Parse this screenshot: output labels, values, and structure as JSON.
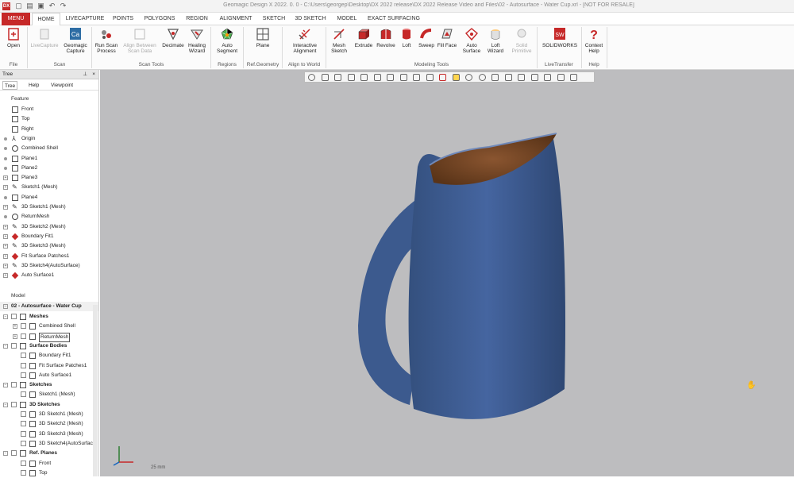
{
  "window": {
    "title": "Geomagic Design X 2022. 0. 0 - C:\\Users\\georgep\\Desktop\\DX 2022 release\\DX 2022 Release Video and Files\\02 - Autosurface - Water Cup.xrl - [NOT FOR RESALE]",
    "app_logo": "DX",
    "quick_access": [
      "new-icon",
      "open-icon",
      "save-icon",
      "undo-icon",
      "redo-icon"
    ]
  },
  "tabs": [
    "MENU",
    "HOME",
    "LIVECAPTURE",
    "POINTS",
    "POLYGONS",
    "REGION",
    "ALIGNMENT",
    "SKETCH",
    "3D SKETCH",
    "MODEL",
    "EXACT SURFACING"
  ],
  "active_tab": "HOME",
  "ribbon": {
    "groups": [
      {
        "label": "File",
        "buttons": [
          {
            "label": "Open",
            "icon": "open-icon"
          }
        ]
      },
      {
        "label": "Scan",
        "buttons": [
          {
            "label": "LiveCapture",
            "icon": "livecapture-icon",
            "disabled": true
          },
          {
            "label": "Geomagic Capture",
            "icon": "capture-icon"
          }
        ]
      },
      {
        "label": "Scan Tools",
        "buttons": [
          {
            "label": "Run Scan Process",
            "icon": "scan-process-icon"
          },
          {
            "label": "Align Between Scan Data",
            "icon": "align-scan-icon",
            "disabled": true
          },
          {
            "label": "Decimate",
            "icon": "decimate-icon"
          },
          {
            "label": "Healing Wizard",
            "icon": "healing-icon"
          }
        ]
      },
      {
        "label": "Regions",
        "buttons": [
          {
            "label": "Auto Segment",
            "icon": "segment-icon"
          }
        ]
      },
      {
        "label": "Ref.Geometry",
        "buttons": [
          {
            "label": "Plane",
            "icon": "plane-icon"
          }
        ]
      },
      {
        "label": "Align to World",
        "buttons": [
          {
            "label": "Interactive Alignment",
            "icon": "alignment-icon"
          }
        ]
      },
      {
        "label": "Modeling Tools",
        "buttons": [
          {
            "label": "Mesh Sketch",
            "icon": "mesh-sketch-icon"
          },
          {
            "label": "Extrude",
            "icon": "extrude-icon"
          },
          {
            "label": "Revolve",
            "icon": "revolve-icon"
          },
          {
            "label": "Loft",
            "icon": "loft-icon"
          },
          {
            "label": "Sweep",
            "icon": "sweep-icon"
          },
          {
            "label": "Fill Face",
            "icon": "fill-face-icon"
          },
          {
            "label": "Auto Surface",
            "icon": "auto-surface-icon"
          },
          {
            "label": "Loft Wizard",
            "icon": "loft-wizard-icon"
          },
          {
            "label": "Solid Primitive",
            "icon": "solid-primitive-icon",
            "disabled": true
          }
        ]
      },
      {
        "label": "LiveTransfer",
        "buttons": [
          {
            "label": "SOLIDWORKS",
            "icon": "solidworks-icon"
          }
        ]
      },
      {
        "label": "Help",
        "buttons": [
          {
            "label": "Context Help",
            "icon": "context-help-icon"
          }
        ]
      }
    ]
  },
  "tree_panel": {
    "title": "Tree",
    "tabs": [
      "Tree",
      "Help",
      "Viewpoint"
    ],
    "feature_label": "Feature",
    "features": [
      "Front",
      "Top",
      "Right",
      "Origin",
      "Combined Shell",
      "Plane1",
      "Plane2",
      "Plane3",
      "Sketch1 (Mesh)",
      "Plane4",
      "3D Sketch1 (Mesh)",
      "ReturnMesh",
      "3D Sketch2 (Mesh)",
      "Boundary Fit1",
      "3D Sketch3 (Mesh)",
      "Fit Surface Patches1",
      "3D Sketch4(AutoSurface)",
      "Auto Surface1"
    ],
    "model_label": "Model",
    "model_root": "02 - Autosurface - Water Cup",
    "model_items": [
      {
        "label": "Meshes",
        "level": 0
      },
      {
        "label": "Combined Shell",
        "level": 1
      },
      {
        "label": "ReturnMesh",
        "level": 1
      },
      {
        "label": "Surface Bodies",
        "level": 0
      },
      {
        "label": "Boundary Fit1",
        "level": 1
      },
      {
        "label": "Fit Surface Patches1",
        "level": 1
      },
      {
        "label": "Auto Surface1",
        "level": 1
      },
      {
        "label": "Sketches",
        "level": 0
      },
      {
        "label": "Sketch1 (Mesh)",
        "level": 1
      },
      {
        "label": "3D Sketches",
        "level": 0
      },
      {
        "label": "3D Sketch1 (Mesh)",
        "level": 1
      },
      {
        "label": "3D Sketch2 (Mesh)",
        "level": 1
      },
      {
        "label": "3D Sketch3 (Mesh)",
        "level": 1
      },
      {
        "label": "3D Sketch4(AutoSurface)",
        "level": 1
      },
      {
        "label": "Ref. Planes",
        "level": 0
      },
      {
        "label": "Front",
        "level": 1
      },
      {
        "label": "Top",
        "level": 1
      }
    ]
  },
  "viewport": {
    "background": "#bdbdbf",
    "model_color": "#3f5f93",
    "inner_color": "#7a4a2a",
    "scale_label": "25 mm"
  },
  "colors": {
    "accent": "#c62828"
  }
}
